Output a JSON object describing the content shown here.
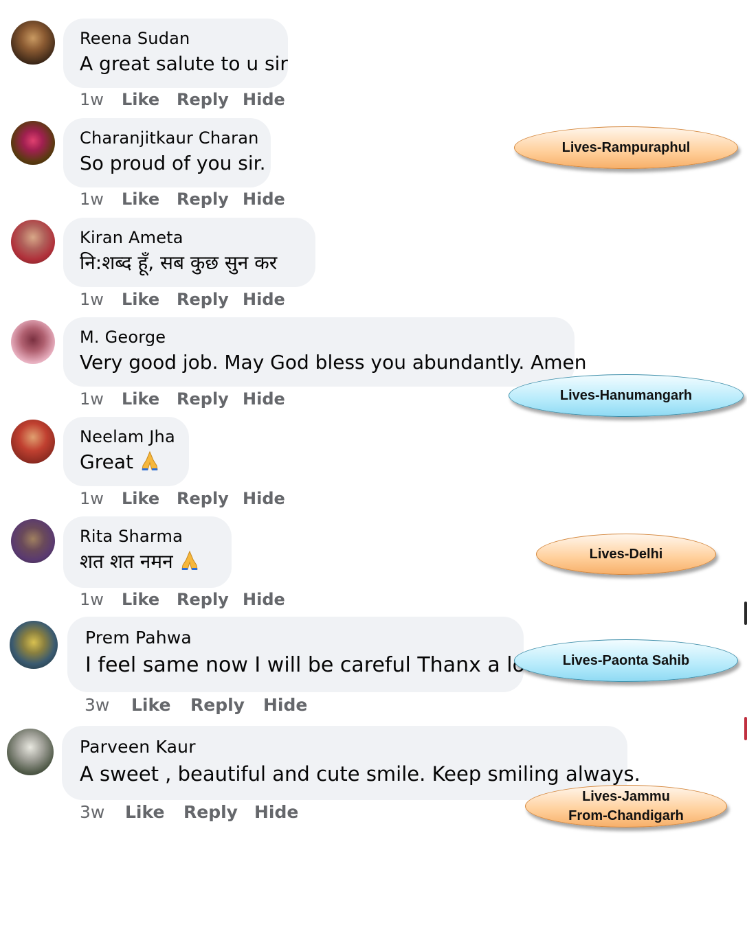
{
  "comments": [
    {
      "author": "Reena Sudan",
      "text": "A great salute to u sir",
      "time": "1w",
      "like": "Like",
      "reply": "Reply",
      "hide": "Hide",
      "has_pray": false
    },
    {
      "author": "Charanjitkaur Charan",
      "text": "So proud of you sir.",
      "time": "1w",
      "like": "Like",
      "reply": "Reply",
      "hide": "Hide",
      "has_pray": false
    },
    {
      "author": "Kiran Ameta",
      "text": "नि:शब्द हूँ, सब कुछ सुन कर",
      "time": "1w",
      "like": "Like",
      "reply": "Reply",
      "hide": "Hide",
      "has_pray": false
    },
    {
      "author": "M. George",
      "text": "Very good job. May God bless you abundantly. Amen",
      "time": "1w",
      "like": "Like",
      "reply": "Reply",
      "hide": "Hide",
      "has_pray": false
    },
    {
      "author": "Neelam Jha",
      "text": "Great",
      "time": "1w",
      "like": "Like",
      "reply": "Reply",
      "hide": "Hide",
      "has_pray": true
    },
    {
      "author": "Rita Sharma",
      "text": "शत शत नमन",
      "time": "1w",
      "like": "Like",
      "reply": "Reply",
      "hide": "Hide",
      "has_pray": true
    },
    {
      "author": "Prem Pahwa",
      "text": "I feel same now I will be careful Thanx a lot",
      "time": "3w",
      "like": "Like",
      "reply": "Reply",
      "hide": "Hide",
      "has_pray": false
    },
    {
      "author": "Parveen Kaur",
      "text": "A sweet , beautiful and cute smile. Keep smiling always.",
      "time": "3w",
      "like": "Like",
      "reply": "Reply",
      "hide": "Hide",
      "has_pray": false
    }
  ],
  "annotations": [
    {
      "label": "Lives-Rampuraphul",
      "style": "orange"
    },
    {
      "label": "Lives-Hanumangarh",
      "style": "blue"
    },
    {
      "label": "Lives-Delhi",
      "style": "orange"
    },
    {
      "label": "Lives-Paonta Sahib",
      "style": "blue"
    },
    {
      "label_line1": "Lives-Jammu",
      "label_line2": "From-Chandigarh",
      "style": "orange"
    }
  ],
  "colors": {
    "bubble_bg": "#f0f2f5",
    "action_text": "#65676b",
    "tag_orange": "#ffcf9a",
    "tag_blue": "#b7ebfb"
  }
}
